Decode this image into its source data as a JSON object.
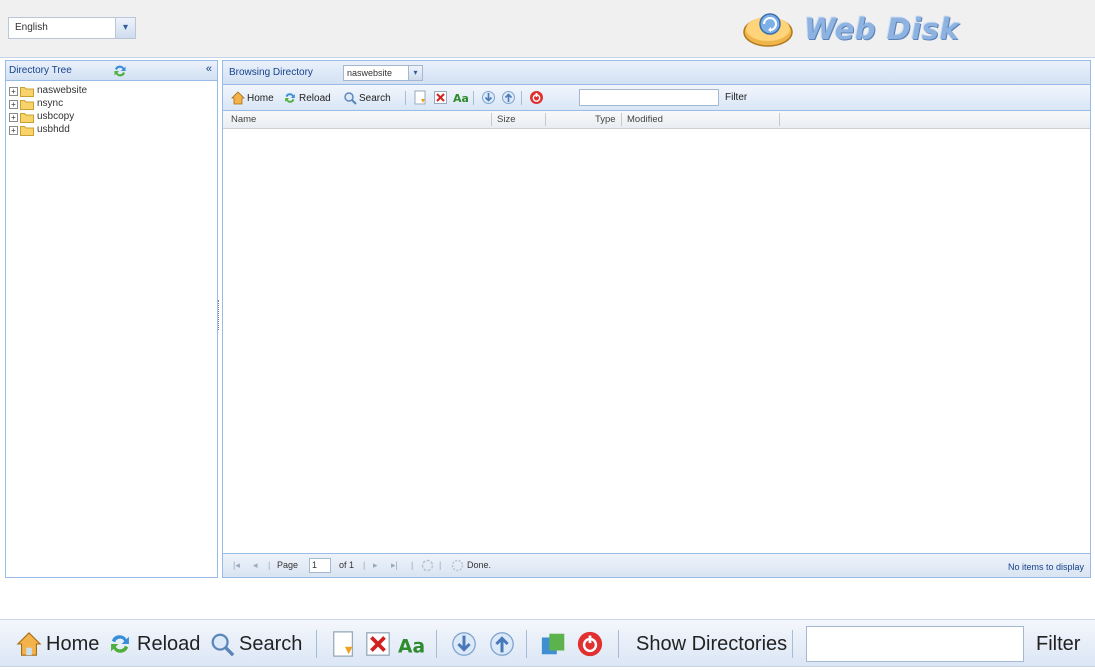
{
  "language": {
    "selected": "English"
  },
  "logo": {
    "text": "Web Disk"
  },
  "directory_tree": {
    "title": "Directory Tree",
    "collapse_glyph": "«",
    "nodes": [
      {
        "label": "naswebsite"
      },
      {
        "label": "nsync"
      },
      {
        "label": "usbcopy"
      },
      {
        "label": "usbhdd"
      }
    ]
  },
  "browsing": {
    "label": "Browsing Directory",
    "selected": "naswebsite"
  },
  "toolbar": {
    "home_label": "Home",
    "reload_label": "Reload",
    "search_label": "Search",
    "filter_label": "Filter",
    "filter_value": ""
  },
  "grid": {
    "columns": [
      "Name",
      "Size",
      "Type",
      "Modified"
    ]
  },
  "pager": {
    "first": "|◂",
    "prev": "◂",
    "page_label": "Page",
    "page_value": "1",
    "of_label": "of 1",
    "next": "▸",
    "last": "▸|",
    "status": "Done.",
    "no_items": "No items to display"
  },
  "zoom_toolbar": {
    "home_label": "Home",
    "reload_label": "Reload",
    "search_label": "Search",
    "show_directories_label": "Show Directories",
    "filter_label": "Filter"
  },
  "colors": {
    "panel_border": "#99bbe8",
    "header_text": "#15428b",
    "logo_blue": "#8eb3e0",
    "delete_red": "#d02020",
    "logout_red": "#e03030"
  },
  "icons": {
    "home": "home-icon",
    "reload": "reload-icon",
    "search": "search-icon",
    "new_file": "new-file-icon",
    "delete": "delete-icon",
    "rename": "rename-icon",
    "download": "download-icon",
    "upload": "upload-icon",
    "show_directories": "show-directories-icon",
    "logout": "logout-icon"
  }
}
